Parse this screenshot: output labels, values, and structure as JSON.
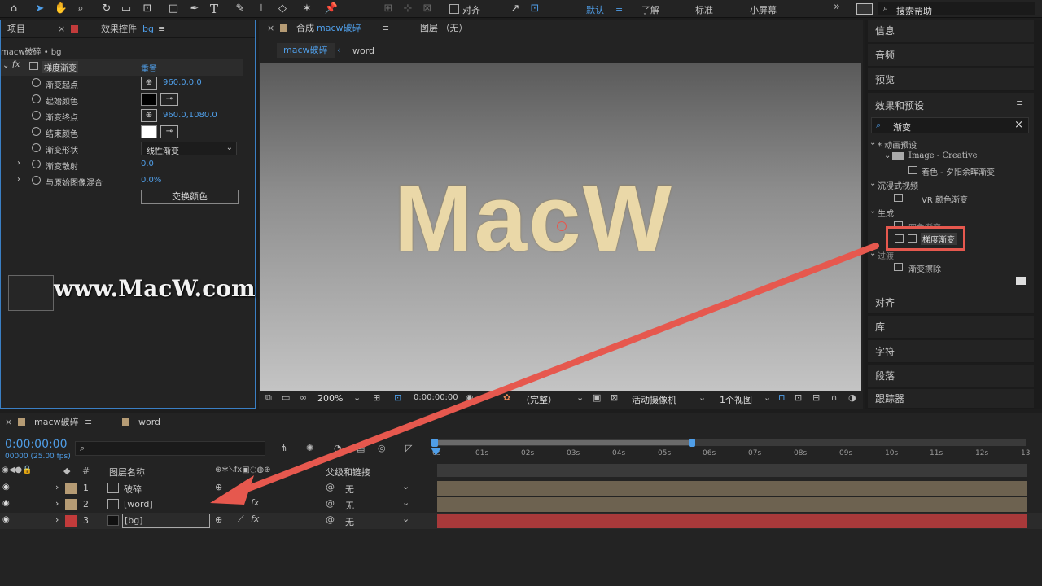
{
  "toolbar": {
    "align_label": "对齐",
    "workspaces": [
      "默认",
      "了解",
      "标准",
      "小屏幕"
    ],
    "search_placeholder": "搜索帮助"
  },
  "project_panel": {
    "tab_project": "项目",
    "tab_effects": "效果控件",
    "tab_effects_target": "bg",
    "layer_path": "macw破碎 • bg",
    "effect_name": "梯度渐变",
    "reset_label": "重置",
    "properties": [
      {
        "name": "渐变起点",
        "value": "960.0,0.0"
      },
      {
        "name": "起始颜色",
        "value": ""
      },
      {
        "name": "渐变终点",
        "value": "960.0,1080.0"
      },
      {
        "name": "结束颜色",
        "value": ""
      },
      {
        "name": "渐变形状",
        "value": "线性渐变"
      },
      {
        "name": "渐变散射",
        "value": "0.0"
      },
      {
        "name": "与原始图像混合",
        "value": "0.0%"
      }
    ],
    "swap_button": "交换颜色"
  },
  "composition": {
    "tab_label": "合成",
    "tab_name": "macw破碎",
    "layer_tab": "图层 （无）",
    "crumb_active": "macw破碎",
    "crumb_next": "word",
    "canvas_text": "MacW",
    "watermark": "www.MacW.com",
    "zoom": "200%",
    "timecode": "0:00:00:00",
    "quality": "（完整）",
    "camera": "活动摄像机",
    "views": "1个视图"
  },
  "right_panel": {
    "items_top": [
      "信息",
      "音频",
      "预览"
    ],
    "effects_title": "效果和预设",
    "search_value": "渐变",
    "tree": [
      "* 动画预设",
      "Image - Creative",
      "着色 - 夕阳余晖渐变",
      "沉浸式视频",
      "VR 颜色渐变",
      "生成",
      "四色渐变",
      "梯度渐变",
      "过渡",
      "渐变擦除"
    ],
    "items_bottom": [
      "对齐",
      "库",
      "字符",
      "段落",
      "跟踪器"
    ]
  },
  "timeline": {
    "tab_comp": "macw破碎",
    "tab_word": "word",
    "timecode": "0:00:00:00",
    "frame_info": "00000 (25.00 fps)",
    "col_hash": "#",
    "col_layer_name": "图层名称",
    "col_parent": "父级和链接",
    "ticks": [
      "0s",
      "01s",
      "02s",
      "03s",
      "04s",
      "05s",
      "06s",
      "07s",
      "08s",
      "09s",
      "10s",
      "11s",
      "12s",
      "13"
    ],
    "layers": [
      {
        "num": "1",
        "name": "破碎",
        "parent": "无",
        "label_color": "#b59b74"
      },
      {
        "num": "2",
        "name": "[word]",
        "parent": "无",
        "label_color": "#b59b74"
      },
      {
        "num": "3",
        "name": "[bg]",
        "parent": "无",
        "label_color": "#c23b3b"
      }
    ]
  },
  "colors": {
    "accent_blue": "#4f9ee8",
    "highlight_red": "#e6584e",
    "panel_bg": "#232323"
  }
}
